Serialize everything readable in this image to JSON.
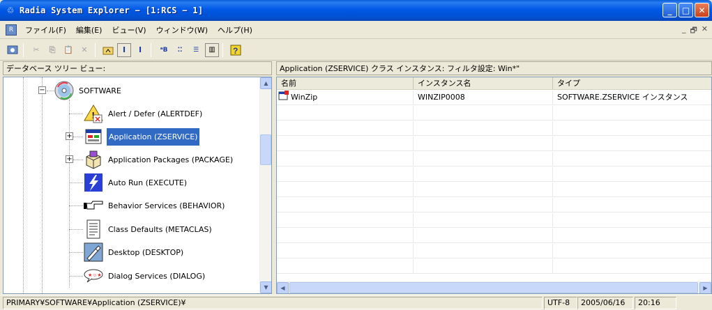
{
  "window": {
    "title": "Radia System Explorer − [1:RCS − 1]",
    "minimize": "_",
    "maximize": "□",
    "close": "✕"
  },
  "menu": {
    "items": [
      "ファイル(F)",
      "編集(E)",
      "ビュー(V)",
      "ウィンドウ(W)",
      "ヘルプ(H)"
    ],
    "mdi_min": "_",
    "mdi_restore": "🗗",
    "mdi_close": "✕"
  },
  "panes": {
    "tree_header": "データベース ツリー ビュー:",
    "list_header": "Application (ZSERVICE) クラス インスタンス: フィルタ設定: Win*\""
  },
  "tree": {
    "root": {
      "label": "SOFTWARE",
      "expander": "−",
      "icon": "cd-icon"
    },
    "items": [
      {
        "label": "Alert / Defer (ALERTDEF)",
        "icon": "alert-icon",
        "expander": ""
      },
      {
        "label": "Application (ZSERVICE)",
        "icon": "application-icon",
        "expander": "+",
        "selected": true
      },
      {
        "label": "Application Packages (PACKAGE)",
        "icon": "packages-icon",
        "expander": "+"
      },
      {
        "label": "Auto Run (EXECUTE)",
        "icon": "lightning-icon",
        "expander": ""
      },
      {
        "label": "Behavior Services (BEHAVIOR)",
        "icon": "pointing-hand-icon",
        "expander": ""
      },
      {
        "label": "Class Defaults (METACLAS)",
        "icon": "document-icon",
        "expander": ""
      },
      {
        "label": "Desktop (DESKTOP)",
        "icon": "desktop-icon",
        "expander": ""
      },
      {
        "label": "Dialog Services (DIALOG)",
        "icon": "dialog-icon",
        "expander": ""
      }
    ]
  },
  "list": {
    "columns": [
      "名前",
      "インスタンス名",
      "タイプ"
    ],
    "rows": [
      {
        "name": "WinZip",
        "instance": "WINZIP0008",
        "type": "SOFTWARE.ZSERVICE インスタンス"
      }
    ]
  },
  "status": {
    "path": "PRIMARY¥SOFTWARE¥Application (ZSERVICE)¥",
    "encoding": "UTF-8",
    "date": "2005/06/16",
    "time": "20:16"
  },
  "colors": {
    "titlebar": "#0058e6",
    "selection": "#316ac5",
    "window_bg": "#ece9d8"
  }
}
